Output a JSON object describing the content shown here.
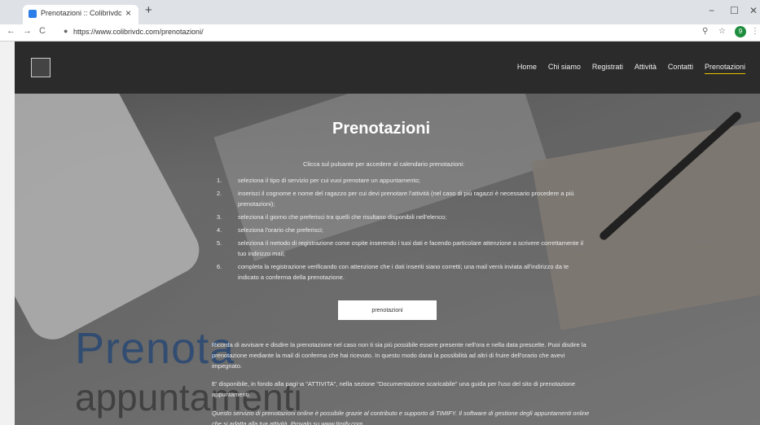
{
  "browser": {
    "tab_title": "Prenotazioni :: Colibrivdc",
    "tab_close": "×",
    "new_tab": "+",
    "url": "https://www.colibrivdc.com/prenotazioni/",
    "back": "←",
    "forward": "→",
    "reload": "C",
    "lock": "🔒",
    "zoom_icon": "⚲",
    "star": "☆",
    "profile": "9",
    "menu": "⋮",
    "minimize": "−",
    "maximize": "☐",
    "close": "✕"
  },
  "nav": {
    "items": [
      "Home",
      "Chi siamo",
      "Registrati",
      "Attività",
      "Contatti",
      "Prenotazioni"
    ],
    "active": "Prenotazioni"
  },
  "main": {
    "title": "Prenotazioni",
    "intro": "Clicca sul pulsante per accedere al calendario prenotazioni:",
    "steps": [
      {
        "num": "1.",
        "text": "seleziona il tipo di servizio per cui vuoi prenotare un appuntamento;"
      },
      {
        "num": "2.",
        "text": "inserisci il cognome e nome del ragazzo per cui devi prenotare l'attività (nel caso di più ragazzi è necessario procedere a più prenotazioni);"
      },
      {
        "num": "3.",
        "text": "seleziona il giorno che preferisci tra quelli che risultano disponibili nell'elenco;"
      },
      {
        "num": "4.",
        "text": "seleziona l'orario che preferisci;"
      },
      {
        "num": "5.",
        "text": "seleziona il metodo di registrazione come ospite inserendo i tuoi dati e facendo particolare attenzione a scrivere correttamente il tuo indirizzo mail;"
      },
      {
        "num": "6.",
        "text": "completa la registrazione verificando con attenzione che i dati inseriti siano corretti; una mail verrà inviata all'indirizzo da te indicato a conferma della prenotazione."
      }
    ],
    "button": "prenotazioni",
    "para1": "Ricorda di avvisare e disdire la prenotazione nel caso non ti sia più possibile essere presente nell'ora e nella data prescelte. Puoi disdire la prenotazione mediante la mail di conferma che hai ricevuto. In questo modo darai la possibilità ad altri di fruire dell'orario che avevi impegnato.",
    "para2": "E' disponibile, in fondo alla pagina \"ATTIVITA\", nella sezione \"Documentazione scaricabile\" una guida per l'uso del sito di prenotazione appuntamenti.",
    "para3": "Questo servizio di prenotazioni online è possibile grazie al contributo e supporto di TIMIFY. Il software di gestione degli appuntamenti online che si adatta alla tua attività. Provalo su www.timify.com",
    "bg_word1": "Prenota",
    "bg_word2": "appuntamenti"
  }
}
